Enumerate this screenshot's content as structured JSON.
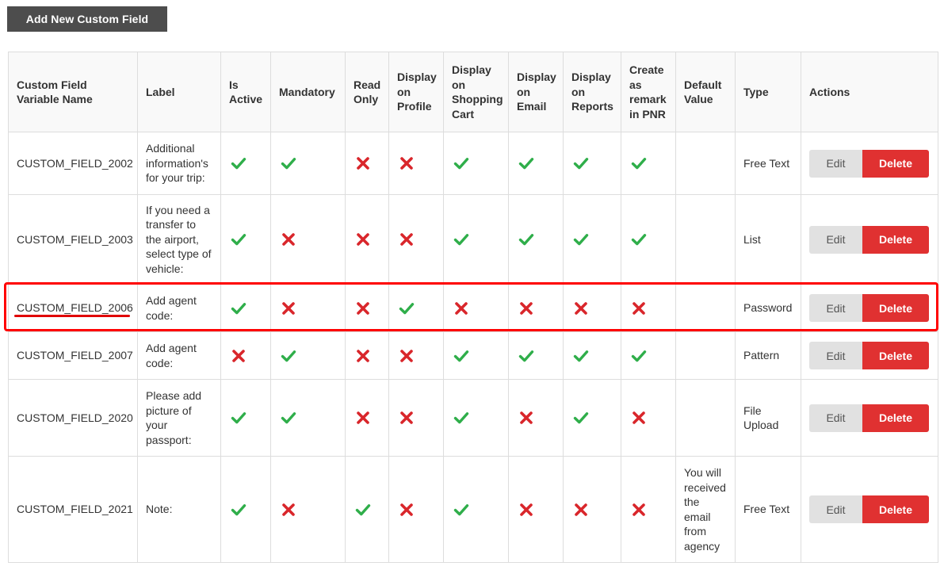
{
  "toolbar": {
    "add_button_label": "Add New Custom Field"
  },
  "colors": {
    "check": "#2fae4a",
    "cross": "#d9262b",
    "delete": "#e03131",
    "edit": "#e1e1e1",
    "highlight": "#ff0000"
  },
  "table": {
    "headers": [
      "Custom Field Variable Name",
      "Label",
      "Is Active",
      "Mandatory",
      "Read Only",
      "Display on Profile",
      "Display on Shopping Cart",
      "Display on Email",
      "Display on Reports",
      "Create as remark in PNR",
      "Default Value",
      "Type",
      "Actions"
    ],
    "edit_label": "Edit",
    "delete_label": "Delete",
    "rows": [
      {
        "name": "CUSTOM_FIELD_2002",
        "label": "Additional information's for your trip:",
        "flags": [
          true,
          true,
          false,
          false,
          true,
          true,
          true,
          true
        ],
        "default": "",
        "type": "Free Text"
      },
      {
        "name": "CUSTOM_FIELD_2003",
        "label": "If you need a transfer to the airport, select type of vehicle:",
        "flags": [
          true,
          false,
          false,
          false,
          true,
          true,
          true,
          true
        ],
        "default": "",
        "type": "List"
      },
      {
        "name": "CUSTOM_FIELD_2006",
        "label": "Add agent code:",
        "flags": [
          true,
          false,
          false,
          true,
          false,
          false,
          false,
          false
        ],
        "default": "",
        "type": "Password"
      },
      {
        "name": "CUSTOM_FIELD_2007",
        "label": "Add agent code:",
        "flags": [
          false,
          true,
          false,
          false,
          true,
          true,
          true,
          true
        ],
        "default": "",
        "type": "Pattern"
      },
      {
        "name": "CUSTOM_FIELD_2020",
        "label": "Please add picture of your passport:",
        "flags": [
          true,
          true,
          false,
          false,
          true,
          false,
          true,
          false
        ],
        "default": "",
        "type": "File Upload"
      },
      {
        "name": "CUSTOM_FIELD_2021",
        "label": "Note:",
        "flags": [
          true,
          false,
          true,
          false,
          true,
          false,
          false,
          false
        ],
        "default": "You will received the email from agency",
        "type": "Free Text"
      }
    ]
  }
}
